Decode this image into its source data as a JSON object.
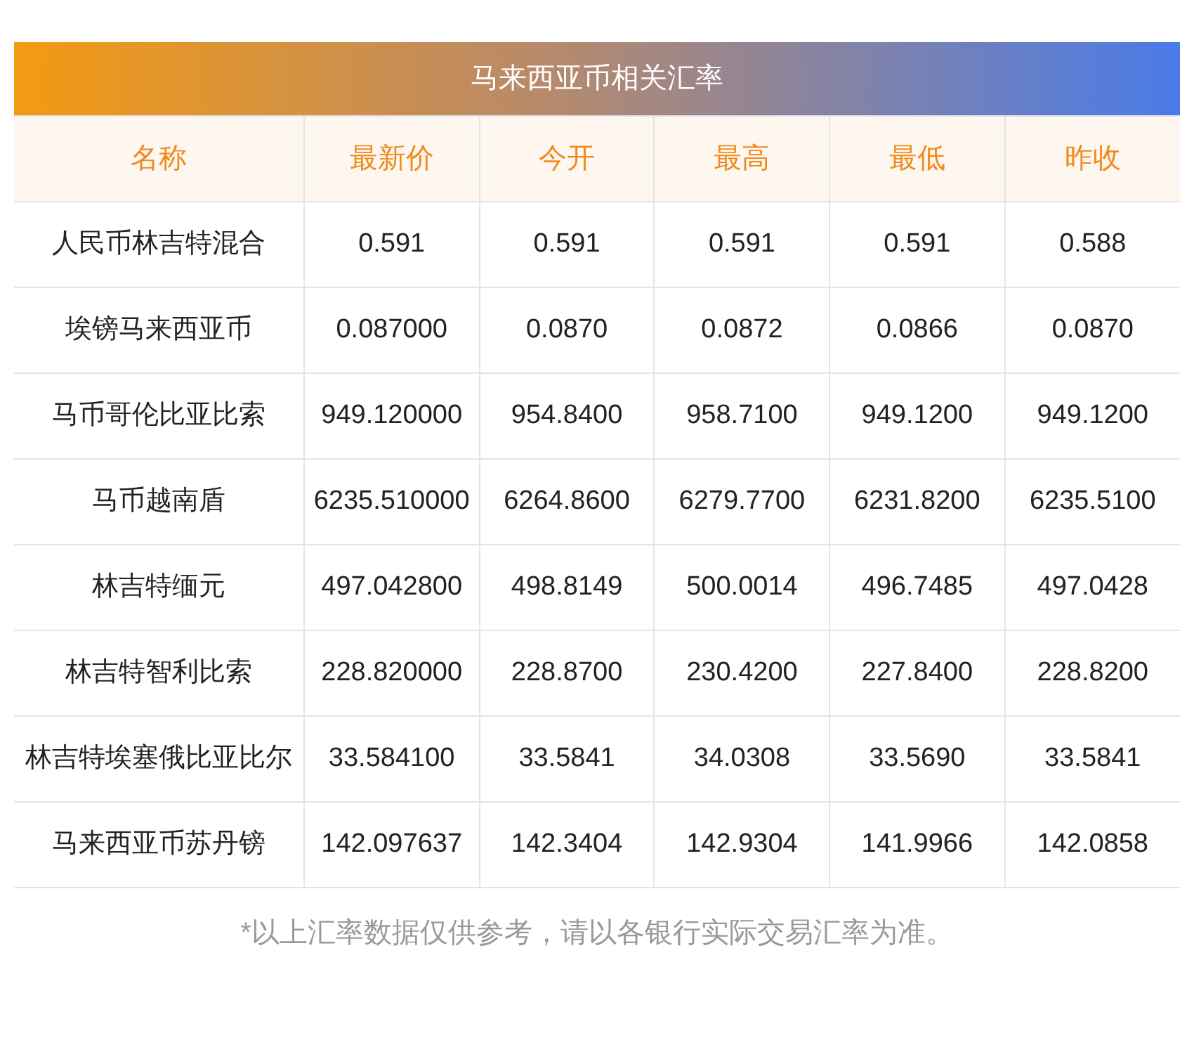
{
  "title": "马来西亚币相关汇率",
  "table": {
    "columns": [
      "名称",
      "最新价",
      "今开",
      "最高",
      "最低",
      "昨收"
    ],
    "rows": [
      [
        "人民币林吉特混合",
        "0.591",
        "0.591",
        "0.591",
        "0.591",
        "0.588"
      ],
      [
        "埃镑马来西亚币",
        "0.087000",
        "0.0870",
        "0.0872",
        "0.0866",
        "0.0870"
      ],
      [
        "马币哥伦比亚比索",
        "949.120000",
        "954.8400",
        "958.7100",
        "949.1200",
        "949.1200"
      ],
      [
        "马币越南盾",
        "6235.510000",
        "6264.8600",
        "6279.7700",
        "6231.8200",
        "6235.5100"
      ],
      [
        "林吉特缅元",
        "497.042800",
        "498.8149",
        "500.0014",
        "496.7485",
        "497.0428"
      ],
      [
        "林吉特智利比索",
        "228.820000",
        "228.8700",
        "230.4200",
        "227.8400",
        "228.8200"
      ],
      [
        "林吉特埃塞俄比亚比尔",
        "33.584100",
        "33.5841",
        "34.0308",
        "33.5690",
        "33.5841"
      ],
      [
        "马来西亚币苏丹镑",
        "142.097637",
        "142.3404",
        "142.9304",
        "141.9966",
        "142.0858"
      ]
    ]
  },
  "footnote": "*以上汇率数据仅供参考，请以各银行实际交易汇率为准。"
}
